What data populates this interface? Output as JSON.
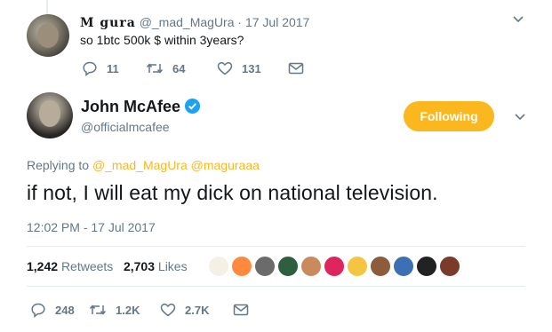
{
  "reply_tweet": {
    "name": "M gura",
    "handle": "@_mad_MagUra",
    "date": "17 Jul 2017",
    "separator": "·",
    "text": "so 1btc 500k $ within 3years?",
    "actions": {
      "replies": "11",
      "retweets": "64",
      "likes": "131"
    }
  },
  "main_tweet": {
    "author_name": "John McAfee",
    "author_handle": "@officialmcafee",
    "follow_label": "Following",
    "replying_prefix": "Replying to",
    "replying_to": "@_mad_MagUra @maguraaa",
    "text": "if not, I will eat my dick on national television.",
    "timestamp": "12:02 PM - 17 Jul 2017",
    "retweets_count": "1,242",
    "retweets_label": "Retweets",
    "likes_count": "2,703",
    "likes_label": "Likes",
    "actions": {
      "replies": "248",
      "retweets": "1.2K",
      "likes": "2.7K"
    }
  },
  "icons": {
    "reply": "reply-icon",
    "retweet": "retweet-icon",
    "like": "heart-icon",
    "message": "envelope-icon",
    "verified": "verified-badge-icon",
    "menu": "chevron-down-icon"
  },
  "colors": {
    "follow_button": "#fab81e",
    "verified": "#1da1f2",
    "secondary_text": "#657786",
    "primary_text": "#14171a"
  },
  "liker_colors": [
    "#f5f0e6",
    "#ff8a3d",
    "#6b6b6b",
    "#2f5f3f",
    "#c98b5e",
    "#e0245e",
    "#f4c542",
    "#8d5c3a",
    "#3d6fb4",
    "#222222",
    "#7a3b2a"
  ]
}
